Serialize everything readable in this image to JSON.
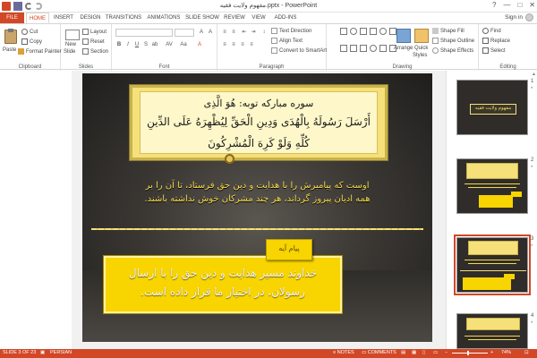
{
  "window": {
    "title": "مفهوم ولایت فقیه.pptx - PowerPoint",
    "controls": [
      "?",
      "—",
      "□",
      "✕"
    ]
  },
  "tabs": [
    {
      "label": "FILE"
    },
    {
      "label": "HOME"
    },
    {
      "label": "INSERT"
    },
    {
      "label": "DESIGN"
    },
    {
      "label": "TRANSITIONS"
    },
    {
      "label": "ANIMATIONS"
    },
    {
      "label": "SLIDE SHOW"
    },
    {
      "label": "REVIEW"
    },
    {
      "label": "VIEW"
    },
    {
      "label": "ADD-INS"
    }
  ],
  "signin": "Sign in",
  "ribbon": {
    "clipboard": {
      "label": "Clipboard",
      "paste": "Paste",
      "cut": "Cut",
      "copy": "Copy",
      "format_painter": "Format Painter"
    },
    "slides": {
      "label": "Slides",
      "new_slide": "New",
      "new_slide_2": "Slide",
      "layout": "Layout",
      "reset": "Reset",
      "section": "Section"
    },
    "font": {
      "label": "Font"
    },
    "paragraph": {
      "label": "Paragraph",
      "text_direction": "Text Direction",
      "align_text": "Align Text",
      "convert_smartart": "Convert to SmartArt"
    },
    "drawing": {
      "label": "Drawing",
      "arrange": "Arrange",
      "quick_styles": "Quick",
      "quick_styles_2": "Styles",
      "shape_fill": "Shape Fill",
      "shape_outline": "Shape Outline",
      "shape_effects": "Shape Effects"
    },
    "editing": {
      "label": "Editing",
      "find": "Find",
      "replace": "Replace",
      "select": "Select"
    }
  },
  "slide": {
    "verse_line1": "سوره مبارکه توبه: هُوَ الَّذِی",
    "verse_line2": "أَرْسَلَ رَسُولَهُ بِالْهُدَی وَدِینِ الْحَقِّ لِیُظْهِرَهُ عَلَی الدِّینِ",
    "verse_line3": "کُلِّهِ وَلَوْ کَرِهَ الْمُشْرِکُونَ",
    "explanation_line1": "اوست که پیامبرش را با هدایت و دین حق فرستاد، تا آن را بر",
    "explanation_line2": "همه ادیان پیروز گرداند، هر چند مشرکان خوش نداشته باشند.",
    "message_tag": "پیام آیه",
    "message_line1": "خداوند مسیر هدایت و دین حق را با ارسال",
    "message_line2": "رسولان، در اختیار ما قرار داده است."
  },
  "thumbnails": [
    {
      "number": "1",
      "title": "مفهوم ولایت فقیه",
      "star": "*"
    },
    {
      "number": "2",
      "star": "*"
    },
    {
      "number": "3",
      "star": "*"
    },
    {
      "number": "4",
      "star": "*"
    }
  ],
  "status": {
    "slide_info": "SLIDE 3 OF 23",
    "language": "PERSIAN",
    "notes": "NOTES",
    "comments": "COMMENTS",
    "zoom": "74%"
  },
  "colors": {
    "accent": "#d24726",
    "verse_box": "#f6e07a",
    "message_box": "#f8d400",
    "explanation_text": "#f3d84a"
  }
}
